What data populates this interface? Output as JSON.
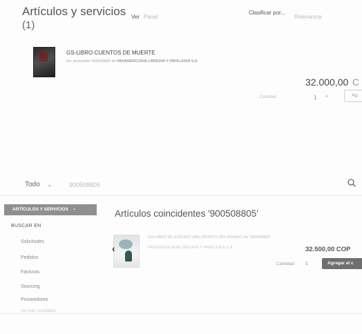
{
  "header": {
    "title": "Artículos y servicios",
    "count": "(1)",
    "view_label": "Ver",
    "view_value": "Panel",
    "sort_label": "Clasificar por...",
    "sort_value": "Relevancia"
  },
  "product": {
    "title": "GS-LIBRO CUENTOS DE MUERTE",
    "subtitle_pre": "De: proveedor 900508805 de",
    "supplier": "PANAMERICANA LIBRERIA Y PAPELERIA S.A.",
    "price": "32.000,00",
    "price_tail": "C",
    "qty_label": "Cantidad",
    "qty_value": "1",
    "qty_plus": "+",
    "add_label": "Ag"
  },
  "search": {
    "scope": "Todo",
    "query": "900508805"
  },
  "sidebar": {
    "header": "ARTÍCULOS Y SERVICIOS",
    "header_chevron": "›",
    "section": "BUSCAR EN",
    "items": [
      {
        "label": "Solicitudes"
      },
      {
        "label": "Pedidos"
      },
      {
        "label": "Facturas"
      },
      {
        "label": "Sourcing"
      },
      {
        "label": "Proveedores"
      }
    ],
    "muted": "Ver más resultados"
  },
  "results": {
    "title": "Artículos coincidentes '900508805'",
    "item_line1": "GS-LIBRO EL ESCUDO MÁS BONITO DEL MUNDO de: 900508805",
    "item_line2": "PANAMERICANA LIBRERIA Y PAPELERIA S.A.",
    "price": "32.500,00 COP",
    "qty_label": "Cantidad",
    "qty_value": "1",
    "add_label": "Agregar al c"
  }
}
